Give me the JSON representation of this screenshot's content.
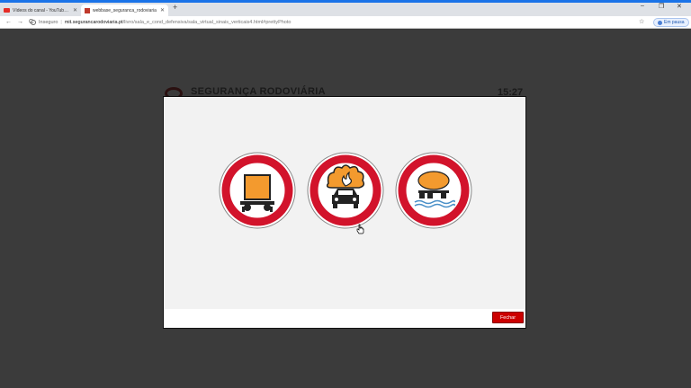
{
  "browser": {
    "tabs": [
      {
        "title": "Vídeos do canal - YouTube Studio",
        "icon": "youtube-icon",
        "active": false
      },
      {
        "title": "webbase_seguranca_rodoviaria",
        "icon": "site-favicon-icon",
        "active": true
      }
    ],
    "new_tab": "+",
    "window_controls": {
      "minimize": "–",
      "maximize": "❐",
      "close": "✕"
    },
    "nav": {
      "back": "←",
      "forward": "→",
      "reload": "C"
    },
    "address": {
      "security_label": "Inseguro",
      "host": "mit.segurancarodoviaria.pt",
      "path": "/livro/sala_e_cond_defensiva/sala_virtual_sinais_verticais4.html#prettyPhoto"
    },
    "bookmark": "☆",
    "profile_pause": "Em pausa"
  },
  "background_page": {
    "title": "SEGURANÇA RODOVIÁRIA",
    "time": "15:27"
  },
  "modal": {
    "signs": [
      {
        "name": "no-dangerous-goods-vehicles",
        "icon": "prohibited-dangerous-goods-sign-icon"
      },
      {
        "name": "no-explosive-flammable-vehicles",
        "icon": "prohibited-explosives-sign-icon"
      },
      {
        "name": "no-water-polluting-goods-vehicles",
        "icon": "prohibited-water-polluting-sign-icon"
      }
    ],
    "close_label": "Fechar"
  },
  "colors": {
    "sign_red": "#d2132b",
    "sign_orange": "#f39a2e",
    "button_red": "#cc0000",
    "chrome_blue": "#1a73e8"
  }
}
